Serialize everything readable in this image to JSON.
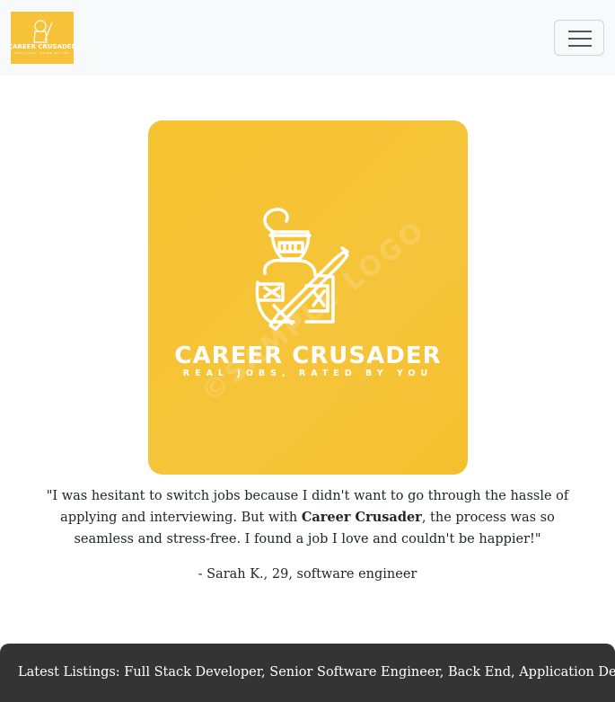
{
  "header": {
    "logo_alt": "Career Crusader",
    "menu_button_label": "Toggle navigation"
  },
  "hero": {
    "brand_name": "CAREER CRUSADER",
    "tagline": "REAL JOBS, RATED BY YOU",
    "watermark": "©SAMPLE LOGO"
  },
  "testimonial": {
    "quote_before": "\"I was hesitant to switch jobs because I didn't want to go through the hassle of applying and interviewing. But with ",
    "quote_brand": "Career Crusader",
    "quote_after": ", the process was so seamless and stress-free. I found a job I love and couldn't be happier!\"",
    "attribution": "- Sarah K., 29, software engineer"
  },
  "ticker": {
    "text": "Latest Listings: Full Stack Developer, Senior Software Engineer, Back End, Application Developer,"
  },
  "colors": {
    "brand_yellow": "#f5c23a",
    "navbar_bg": "#f8f9fa",
    "ticker_bg": "#343434"
  },
  "icons": {
    "menu": "hamburger-icon",
    "mascot": "knight-icon"
  }
}
